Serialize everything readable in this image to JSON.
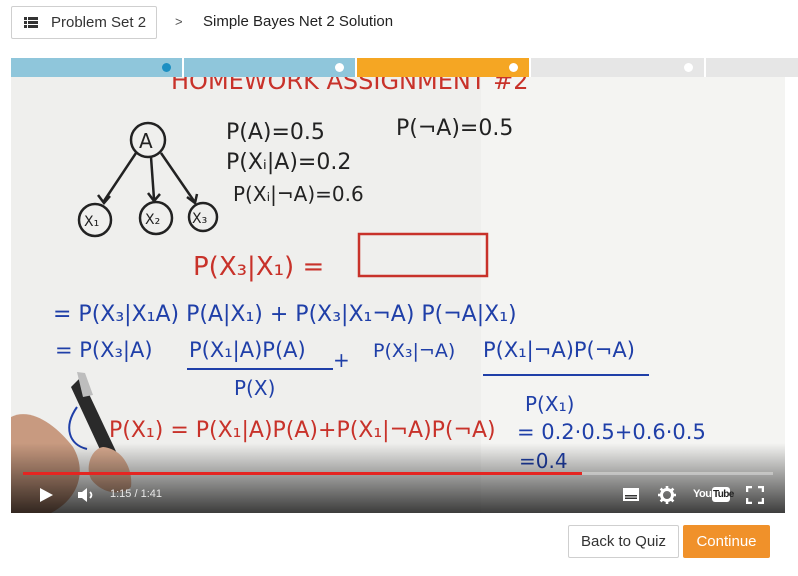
{
  "header": {
    "problem_set_label": "Problem Set 2",
    "separator": ">",
    "lesson_title": "Simple Bayes Net 2 Solution"
  },
  "progress": {
    "segments": [
      {
        "state": "done",
        "color": "#8fc6db",
        "dot_color": "#1d8fc2"
      },
      {
        "state": "done",
        "color": "#8fc6db",
        "dot_color": "#ffffff"
      },
      {
        "state": "current",
        "color": "#f5a623",
        "dot_color": "#ffffff"
      },
      {
        "state": "todo",
        "color": "#e6e6e6",
        "dot_color": "#ffffff"
      },
      {
        "state": "todo",
        "color": "#e6e6e6",
        "dot_color": ""
      }
    ]
  },
  "video": {
    "board": {
      "heading": "HOMEWORK ASSIGNMENT #2",
      "node_a": "A",
      "node_x1": "X₁",
      "node_x2": "X₂",
      "node_x3": "X₃",
      "eq_pa": "P(A)=0.5",
      "eq_pna": "P(¬A)=0.5",
      "eq_pxa": "P(Xᵢ|A)=0.2",
      "eq_pxna": "P(Xᵢ|¬A)=0.6",
      "query": "P(X₃|X₁) =",
      "line1": "= P(X₃|X₁A) P(A|X₁) + P(X₃|X₁¬A) P(¬A|X₁)",
      "line2a": "= P(X₃|A)",
      "line2_num1": "P(X₁|A)P(A)",
      "line2_plus": "+",
      "line2b": "P(X₃|¬A)",
      "line2_num2": "P(X₁|¬A)P(¬A)",
      "den1": "P(X)",
      "den2": "P(X₁)",
      "line3": "P(X₁) = P(X₁|A)P(A)+P(X₁|¬A)P(¬A)",
      "line3_val": "= 0.2·0.5+0.6·0.5",
      "line4": "=0.4"
    },
    "current_time": "1:15",
    "duration": "1:41",
    "time_display": "1:15 / 1:41",
    "played_fraction": 0.745,
    "youtube_label": "YouTube"
  },
  "footer": {
    "back_label": "Back to Quiz",
    "continue_label": "Continue"
  },
  "colors": {
    "accent": "#f0912a",
    "progress_done": "#8fc6db",
    "progress_current": "#f5a623",
    "scrub_red": "#e52521"
  }
}
